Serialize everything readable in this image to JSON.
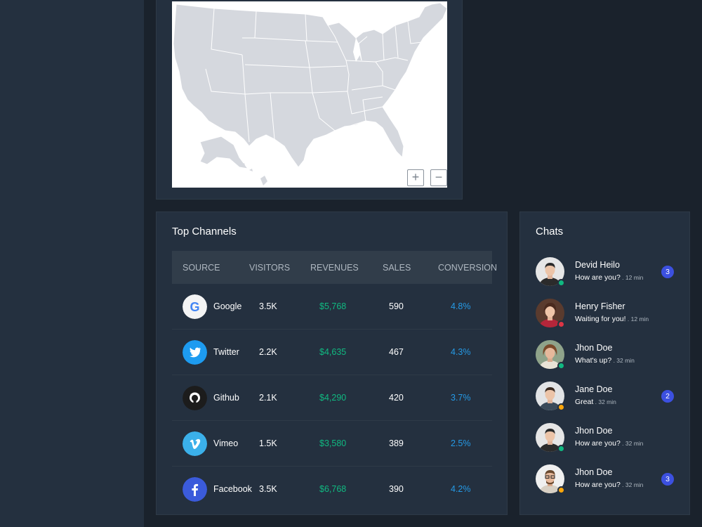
{
  "map": {
    "zoom_in_label": "+",
    "zoom_out_label": "−",
    "land_color": "#d5d8de",
    "border_color": "#ffffff"
  },
  "channels": {
    "title": "Top Channels",
    "headers": [
      "SOURCE",
      "VISITORS",
      "REVENUES",
      "SALES",
      "CONVERSION"
    ],
    "rows": [
      {
        "icon": "google-icon",
        "name": "Google",
        "visitors": "3.5K",
        "revenues": "$5,768",
        "sales": "590",
        "conversion": "4.8%"
      },
      {
        "icon": "twitter-icon",
        "name": "Twitter",
        "visitors": "2.2K",
        "revenues": "$4,635",
        "sales": "467",
        "conversion": "4.3%"
      },
      {
        "icon": "github-icon",
        "name": "Github",
        "visitors": "2.1K",
        "revenues": "$4,290",
        "sales": "420",
        "conversion": "3.7%"
      },
      {
        "icon": "vimeo-icon",
        "name": "Vimeo",
        "visitors": "1.5K",
        "revenues": "$3,580",
        "sales": "389",
        "conversion": "2.5%"
      },
      {
        "icon": "facebook-icon",
        "name": "Facebook",
        "visitors": "3.5K",
        "revenues": "$6,768",
        "sales": "390",
        "conversion": "4.2%"
      }
    ]
  },
  "chats": {
    "title": "Chats",
    "items": [
      {
        "name": "Devid Heilo",
        "message": "How are you?",
        "time": " . 12 min",
        "badge": "3",
        "status_color": "#10b981"
      },
      {
        "name": "Henry Fisher",
        "message": "Waiting for you!",
        "time": " . 12 min",
        "badge": "",
        "status_color": "#dc3545"
      },
      {
        "name": "Jhon Doe",
        "message": "What's up?",
        "time": " . 32 min",
        "badge": "",
        "status_color": "#10b981"
      },
      {
        "name": "Jane Doe",
        "message": "Great",
        "time": " . 32 min",
        "badge": "2",
        "status_color": "#ffa70b"
      },
      {
        "name": "Jhon Doe",
        "message": "How are you?",
        "time": " . 32 min",
        "badge": "",
        "status_color": "#10b981"
      },
      {
        "name": "Jhon Doe",
        "message": "How are you?",
        "time": " . 32 min",
        "badge": "3",
        "status_color": "#ffa70b"
      }
    ]
  },
  "colors": {
    "background": "#1a222c",
    "card": "#24303f",
    "revenue": "#10b981",
    "conversion": "#259ae6",
    "badge": "#3c50e0"
  }
}
